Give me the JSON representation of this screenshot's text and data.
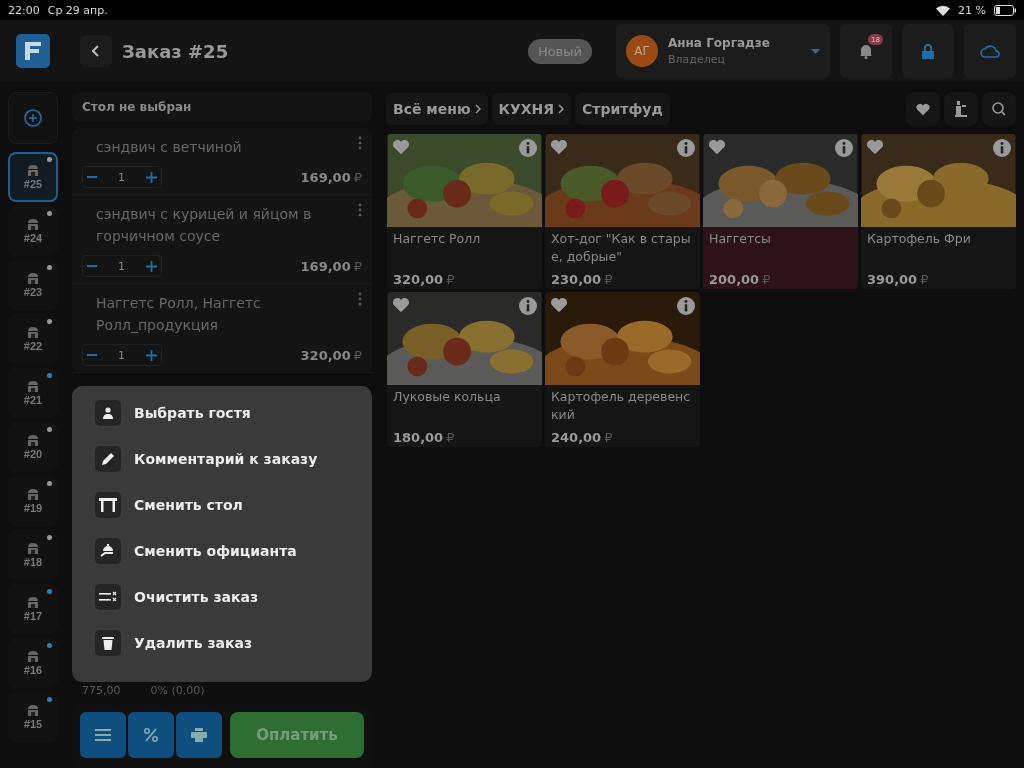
{
  "status_bar": {
    "time": "22:00",
    "date": "Ср 29 апр.",
    "battery": "21 %"
  },
  "header": {
    "title": "Заказ #25",
    "status": "Новый",
    "user": {
      "initials": "АГ",
      "name": "Анна Горгадзе",
      "role": "Владелец"
    },
    "notifications": "18"
  },
  "order_tabs": [
    {
      "label": "#25",
      "selected": true,
      "color": "#9a9a9a"
    },
    {
      "label": "#24",
      "selected": false,
      "color": "#9a9a9a"
    },
    {
      "label": "#23",
      "selected": false,
      "color": "#9a9a9a"
    },
    {
      "label": "#22",
      "selected": false,
      "color": "#9a9a9a"
    },
    {
      "label": "#21",
      "selected": false,
      "color": "#2a7fc0"
    },
    {
      "label": "#20",
      "selected": false,
      "color": "#9a9a9a"
    },
    {
      "label": "#19",
      "selected": false,
      "color": "#9a9a9a"
    },
    {
      "label": "#18",
      "selected": false,
      "color": "#9a9a9a"
    },
    {
      "label": "#17",
      "selected": false,
      "color": "#2a7fc0"
    },
    {
      "label": "#16",
      "selected": false,
      "color": "#2a7fc0"
    },
    {
      "label": "#15",
      "selected": false,
      "color": "#2a7fc0"
    }
  ],
  "order": {
    "table": "Стол не выбран",
    "items": [
      {
        "name": "сэндвич с ветчиной",
        "qty": "1",
        "price": "169,00",
        "currency": "₽"
      },
      {
        "name": "сэндвич с курицей и яйцом в горчичном соусе",
        "qty": "1",
        "price": "169,00",
        "currency": "₽"
      },
      {
        "name": "Наггетс Ролл, Наггетс Ролл_продукция",
        "qty": "1",
        "price": "320,00",
        "currency": "₽"
      }
    ],
    "summary": [
      "775,00",
      "0% (0,00)"
    ],
    "pay_button": "Оплатить"
  },
  "context_menu": [
    "Выбрать гостя",
    "Комментарий к заказу",
    "Сменить стол",
    "Сменить официанта",
    "Очистить заказ",
    "Удалить заказ"
  ],
  "breadcrumbs": [
    "Всё меню",
    "КУХНЯ",
    "Стритфуд"
  ],
  "products": [
    {
      "name": "Наггетс Ролл",
      "price": "320,00",
      "currency": "₽",
      "highlighted": false
    },
    {
      "name": "Хот-дог \"Как в стары е, добрые\"",
      "price": "230,00",
      "currency": "₽",
      "highlighted": false
    },
    {
      "name": "Наггетсы",
      "price": "200,00",
      "currency": "₽",
      "highlighted": true
    },
    {
      "name": "Картофель Фри",
      "price": "390,00",
      "currency": "₽",
      "highlighted": false
    },
    {
      "name": "Луковые кольца",
      "price": "180,00",
      "currency": "₽",
      "highlighted": false
    },
    {
      "name": "Картофель деревенс кий",
      "price": "240,00",
      "currency": "₽",
      "highlighted": false
    }
  ]
}
